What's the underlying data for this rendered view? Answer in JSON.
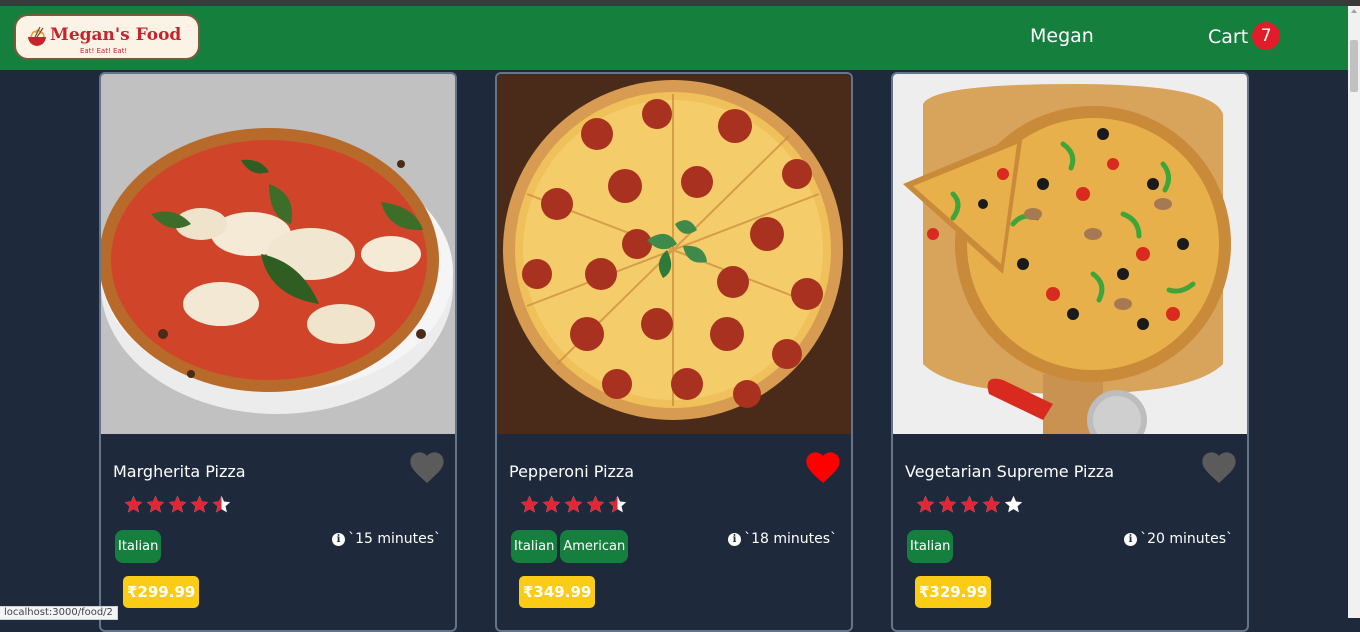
{
  "navbar": {
    "logo_title": "Megan's Food",
    "logo_tagline": "Eat! Eat! Eat!",
    "user_name": "Megan",
    "cart_label": "Cart",
    "cart_count": "7",
    "bg_color": "#15803d"
  },
  "cards": [
    {
      "name": "Margherita Pizza",
      "favorite": false,
      "rating": 4.5,
      "tags": [
        "Italian"
      ],
      "time": "`15 minutes`",
      "price": "₹299.99"
    },
    {
      "name": "Pepperoni Pizza",
      "favorite": true,
      "rating": 4.5,
      "tags": [
        "Italian",
        "American"
      ],
      "time": "`18 minutes`",
      "price": "₹349.99"
    },
    {
      "name": "Vegetarian Supreme Pizza",
      "favorite": false,
      "rating": 4,
      "tags": [
        "Italian"
      ],
      "time": "`20 minutes`",
      "price": "₹329.99"
    }
  ],
  "status_url": "localhost:3000/food/2",
  "colors": {
    "background": "#1e293b",
    "star": "#e32636",
    "favorite_on": "#ff0000",
    "favorite_off": "#5b5b5b",
    "tag": "#15803d",
    "price": "#facc15"
  },
  "icons": {
    "favorite": "heart-icon",
    "rating": "star-icon",
    "time": "info-icon",
    "logo": "noodle-bowl-icon"
  }
}
